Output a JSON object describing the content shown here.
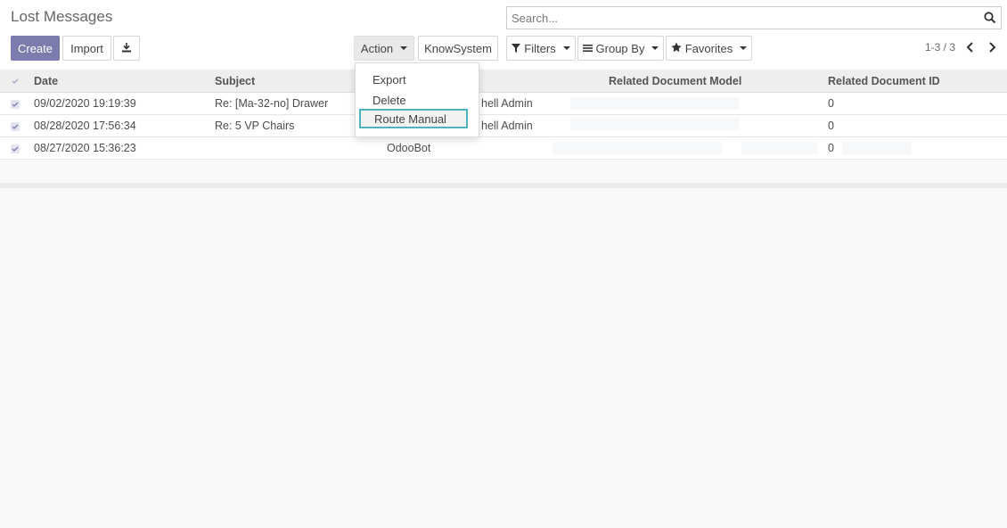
{
  "header": {
    "title": "Lost Messages"
  },
  "search": {
    "placeholder": "Search..."
  },
  "buttons": {
    "create": "Create",
    "import": "Import",
    "action": "Action",
    "knowsystem": "KnowSystem",
    "filters": "Filters",
    "group_by": "Group By",
    "favorites": "Favorites"
  },
  "pager": {
    "text": "1-3 / 3"
  },
  "columns": {
    "date": "Date",
    "subject": "Subject",
    "related_model": "Related Document Model",
    "related_id": "Related Document ID"
  },
  "rows": [
    {
      "date": "09/02/2020 19:19:39",
      "subject": "Re: [Ma-32-no] Drawer",
      "author": "hell Admin",
      "related_id": "0"
    },
    {
      "date": "08/28/2020 17:56:34",
      "subject": "Re: 5 VP Chairs",
      "author": "hell Admin",
      "related_id": "0"
    },
    {
      "date": "08/27/2020 15:36:23",
      "subject": "",
      "author": "OdooBot",
      "related_id": "0"
    }
  ],
  "action_menu": {
    "items": [
      "Export",
      "Delete",
      "Route Manual"
    ]
  },
  "colors": {
    "primary": "#7c7bad",
    "highlight": "#4fb3bf",
    "header_bg": "#eeeeee"
  },
  "icons": [
    "search-icon",
    "download-icon",
    "filter-icon",
    "group-by-icon",
    "star-icon",
    "chevron-left-icon",
    "chevron-right-icon",
    "checkbox-icon"
  ]
}
